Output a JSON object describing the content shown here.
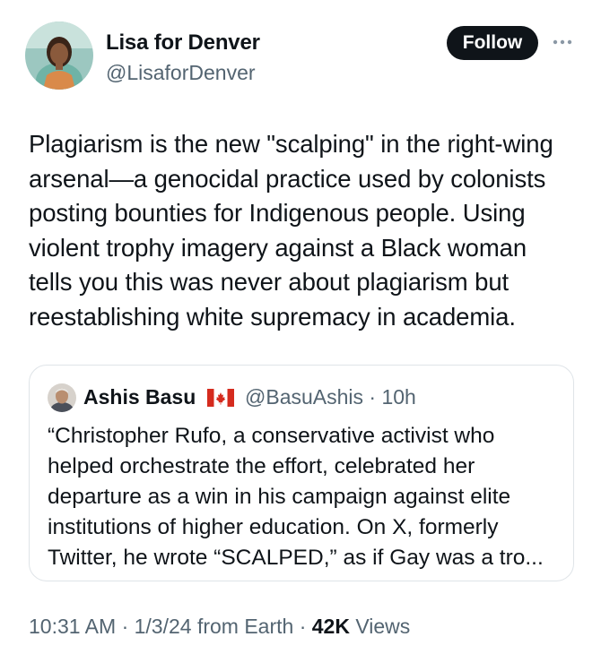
{
  "author": {
    "display_name": "Lisa for Denver",
    "handle": "@LisaforDenver",
    "follow_label": "Follow",
    "more_icon": "ellipsis-icon"
  },
  "tweet": {
    "text": "Plagiarism is the new \"scalping\" in the right-wing\narsenal—a genocidal practice used by colonists\nposting bounties for Indigenous people. Using\nviolent trophy imagery against a Black woman\ntells you this was never about plagiarism but\nreestablishing white supremacy in academia."
  },
  "quote": {
    "display_name": "Ashis Basu",
    "flag": "canada-flag-icon",
    "meta": "@BasuAshis · 10h",
    "text": "“Christopher Rufo, a conservative activist who\nhelped orchestrate the effort, celebrated her\ndeparture as a win in his campaign against elite\ninstitutions of higher education. On X, formerly\nTwitter, he wrote “SCALPED,” as if Gay was a tro..."
  },
  "footer": {
    "time": "10:31 AM · 1/3/24 from Earth · ",
    "views_count": "42K",
    "views_label": " Views"
  },
  "colors": {
    "text": "#0f1419",
    "secondary": "#536471",
    "border": "#dfe4e8",
    "button": "#0f1419"
  }
}
